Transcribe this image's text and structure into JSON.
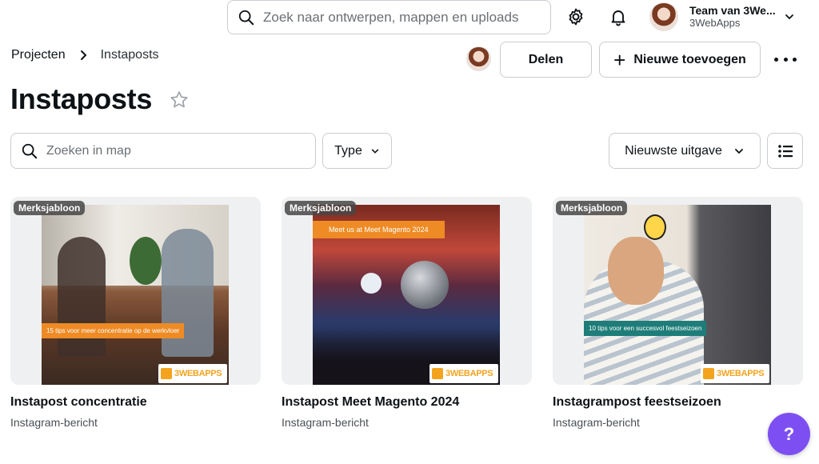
{
  "top_search": {
    "placeholder": "Zoek naar ontwerpen, mappen en uploads"
  },
  "account": {
    "team": "Team van 3We...",
    "org": "3WebApps"
  },
  "breadcrumb": {
    "parent": "Projecten",
    "current": "Instaposts"
  },
  "actions": {
    "share_label": "Delen",
    "add_label": "Nieuwe toevoegen"
  },
  "page": {
    "title": "Instaposts"
  },
  "filters": {
    "folder_search_placeholder": "Zoeken in map",
    "type_label": "Type",
    "sort_label": "Nieuwste uitgave"
  },
  "cards": [
    {
      "badge": "Merksjabloon",
      "name": "Instapost concentratie",
      "kind": "Instagram-bericht",
      "banner": "15 tips voor meer concentratie op de werkvloer",
      "logo": "3WEBAPPS"
    },
    {
      "badge": "Merksjabloon",
      "name": "Instapost Meet Magento 2024",
      "kind": "Instagram-bericht",
      "banner": "Meet us at Meet Magento 2024",
      "logo": "3WEBAPPS"
    },
    {
      "badge": "Merksjabloon",
      "name": "Instagrampost feestseizoen",
      "kind": "Instagram-bericht",
      "banner": "10 tips voor een succesvol feestseizoen",
      "logo": "3WEBAPPS"
    }
  ],
  "help": {
    "label": "?"
  },
  "colors": {
    "help_purple": "#7d4ff2",
    "banner_orange": "#ee8b24",
    "banner_teal": "#1e7d78"
  }
}
